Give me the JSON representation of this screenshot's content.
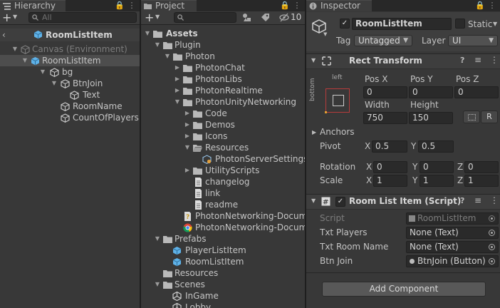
{
  "hierarchy": {
    "tab_label": "Hierarchy",
    "search_placeholder": "All",
    "add_label": "+",
    "scene_root": "RoomListItem",
    "items": [
      {
        "label": "Canvas (Environment)"
      },
      {
        "label": "RoomListItem"
      },
      {
        "label": "bg"
      },
      {
        "label": "BtnJoin"
      },
      {
        "label": "Text"
      },
      {
        "label": "RoomName"
      },
      {
        "label": "CountOfPlayers"
      }
    ]
  },
  "project": {
    "tab_label": "Project",
    "add_label": "+",
    "hidden_count": "10",
    "items": [
      {
        "label": "Assets"
      },
      {
        "label": "Plugin"
      },
      {
        "label": "Photon"
      },
      {
        "label": "PhotonChat"
      },
      {
        "label": "PhotonLibs"
      },
      {
        "label": "PhotonRealtime"
      },
      {
        "label": "PhotonUnityNetworking"
      },
      {
        "label": "Code"
      },
      {
        "label": "Demos"
      },
      {
        "label": "Icons"
      },
      {
        "label": "Resources"
      },
      {
        "label": "PhotonServerSettings"
      },
      {
        "label": "UtilityScripts"
      },
      {
        "label": "changelog"
      },
      {
        "label": "link"
      },
      {
        "label": "readme"
      },
      {
        "label": "PhotonNetworking-Docume"
      },
      {
        "label": "PhotonNetworking-Docume"
      },
      {
        "label": "Prefabs"
      },
      {
        "label": "PlayerListItem"
      },
      {
        "label": "RoomListItem"
      },
      {
        "label": "Resources"
      },
      {
        "label": "Scenes"
      },
      {
        "label": "InGame"
      },
      {
        "label": "Lobby"
      }
    ]
  },
  "inspector": {
    "tab_label": "Inspector",
    "object_name": "RoomListItem",
    "static_label": "Static",
    "tag_label": "Tag",
    "tag_value": "Untagged",
    "layer_label": "Layer",
    "layer_value": "UI",
    "rect_transform": {
      "title": "Rect Transform",
      "anchor_top_label": "left",
      "anchor_side_label": "bottom",
      "posx_label": "Pos X",
      "posy_label": "Pos Y",
      "posz_label": "Pos Z",
      "posx": "0",
      "posy": "0",
      "posz": "0",
      "width_label": "Width",
      "height_label": "Height",
      "width": "750",
      "height": "150",
      "r_button": "R",
      "anchors_label": "Anchors",
      "pivot_label": "Pivot",
      "pivot_x": "0.5",
      "pivot_y": "0.5",
      "rotation_label": "Rotation",
      "rot_x": "0",
      "rot_y": "0",
      "rot_z": "0",
      "scale_label": "Scale",
      "scale_x": "1",
      "scale_y": "1",
      "scale_z": "1",
      "x": "X",
      "y": "Y",
      "z": "Z"
    },
    "script_component": {
      "title": "Room List Item (Script)",
      "script_label": "Script",
      "script_value": "RoomListItem",
      "txt_players_label": "Txt Players",
      "txt_players_value": "None (Text)",
      "txt_room_label": "Txt Room Name",
      "txt_room_value": "None (Text)",
      "btn_join_label": "Btn Join",
      "btn_join_value": "BtnJoin (Button)"
    },
    "add_component_label": "Add Component"
  },
  "colors": {
    "panel_bg": "#383838",
    "selection": "#4d4d4d",
    "folder": "#b9b9b9",
    "prefab_blue": "#5fb2e8"
  }
}
